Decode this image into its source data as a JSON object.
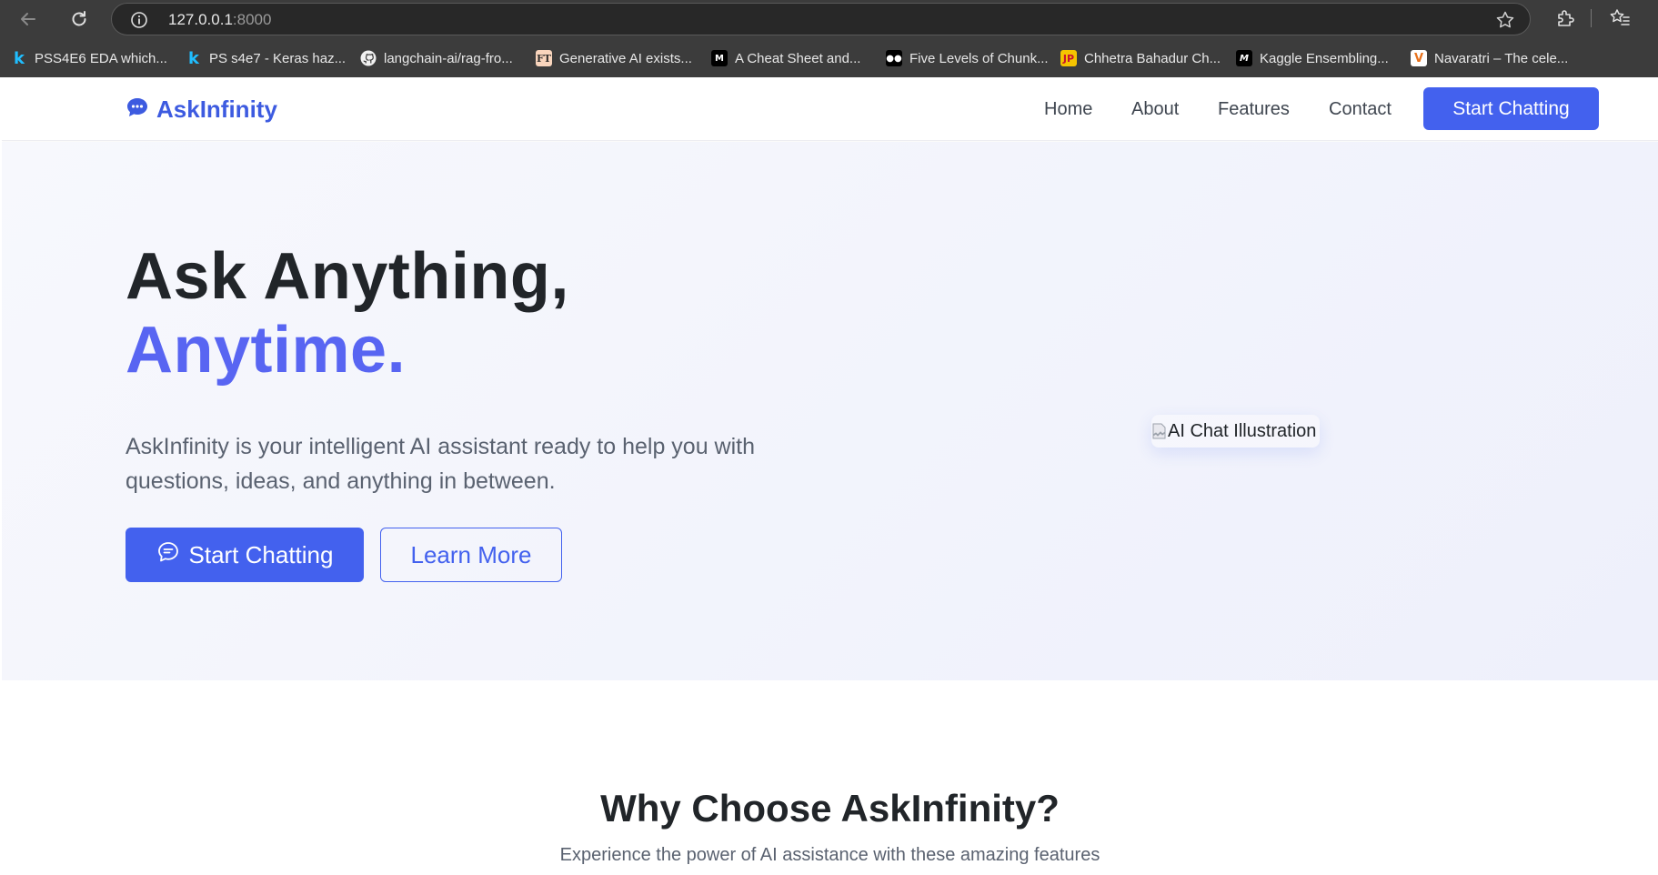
{
  "browser": {
    "url_host": "127.0.0.1",
    "url_port": ":8000",
    "bookmarks": [
      {
        "label": "PSS4E6 EDA which...",
        "icon": "kaggle-icon"
      },
      {
        "label": "PS s4e7 - Keras haz...",
        "icon": "kaggle-icon"
      },
      {
        "label": "langchain-ai/rag-fro...",
        "icon": "github-icon"
      },
      {
        "label": "Generative AI exists...",
        "icon": "ft-icon"
      },
      {
        "label": "A Cheat Sheet and...",
        "icon": "medium-icon"
      },
      {
        "label": "Five Levels of Chunk...",
        "icon": "medium-icon"
      },
      {
        "label": "Chhetra Bahadur Ch...",
        "icon": "jp-icon"
      },
      {
        "label": "Kaggle Ensembling...",
        "icon": "ml-icon"
      },
      {
        "label": "Navaratri – The cele...",
        "icon": "vedic-icon"
      }
    ]
  },
  "navbar": {
    "brand": "AskInfinity",
    "links": [
      "Home",
      "About",
      "Features",
      "Contact"
    ],
    "cta": "Start Chatting"
  },
  "hero": {
    "title_line1": "Ask Anything,",
    "title_line2": "Anytime.",
    "description": "AskInfinity is your intelligent AI assistant ready to help you with questions, ideas, and anything in between.",
    "primary_button": "Start Chatting",
    "secondary_button": "Learn More",
    "image_alt": "AI Chat Illustration"
  },
  "features": {
    "title": "Why Choose AskInfinity?",
    "subtitle": "Experience the power of AI assistance with these amazing features"
  },
  "colors": {
    "accent": "#4361ee",
    "headline_accent": "#5865f2",
    "chrome": "#3c3c3c"
  }
}
